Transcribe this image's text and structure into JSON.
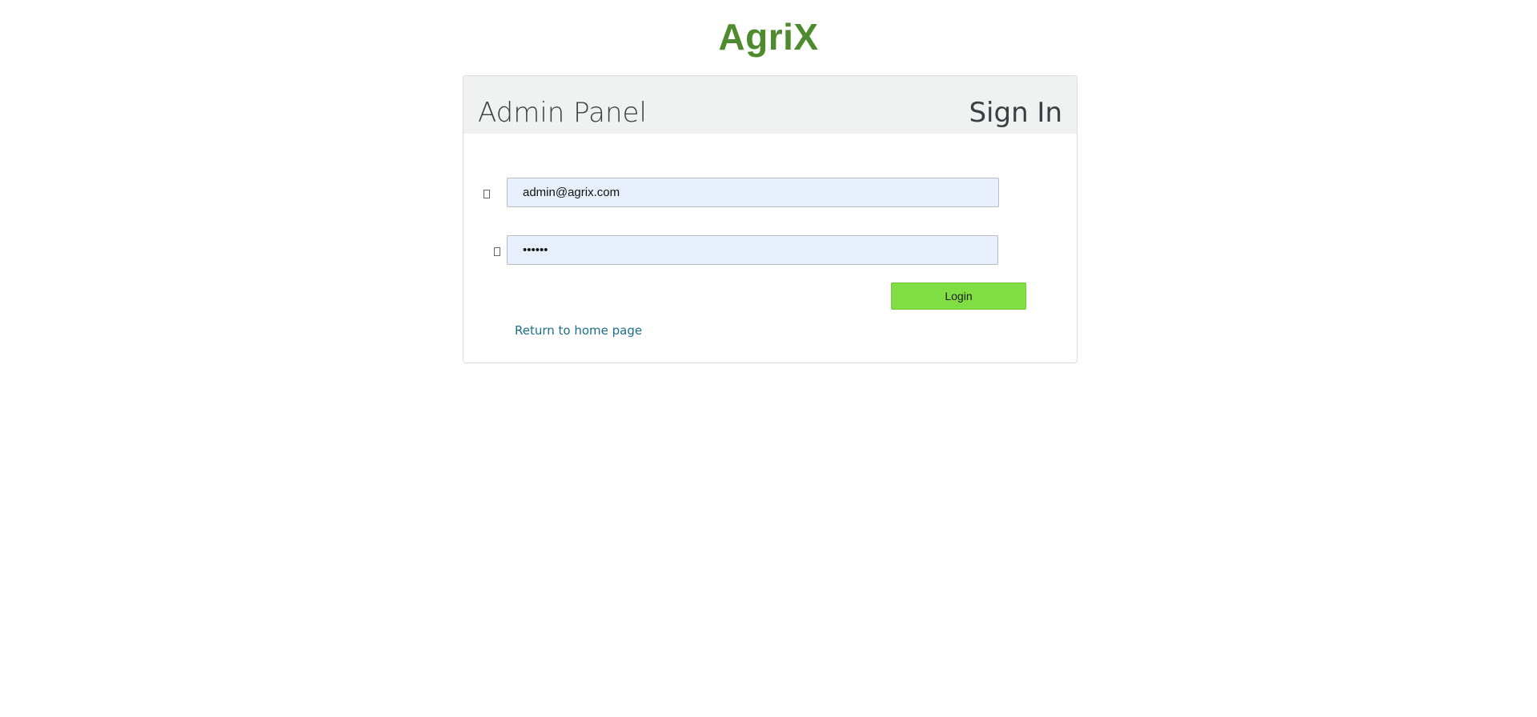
{
  "header": {
    "logo_text": "AgriX"
  },
  "panel": {
    "title": "Admin Panel",
    "sign_in_label": "Sign In"
  },
  "form": {
    "email_value": "admin@agrix.com",
    "password_value": "••••••",
    "login_label": "Login",
    "home_link_label": "Return to home page"
  },
  "icons": {
    "email_icon": "email-icon",
    "password_icon": "lock-icon"
  },
  "colors": {
    "brand_green": "#4e8a2e",
    "login_button": "#80dd43",
    "link": "#1e6e8c",
    "input_background": "#e8f0fe"
  }
}
